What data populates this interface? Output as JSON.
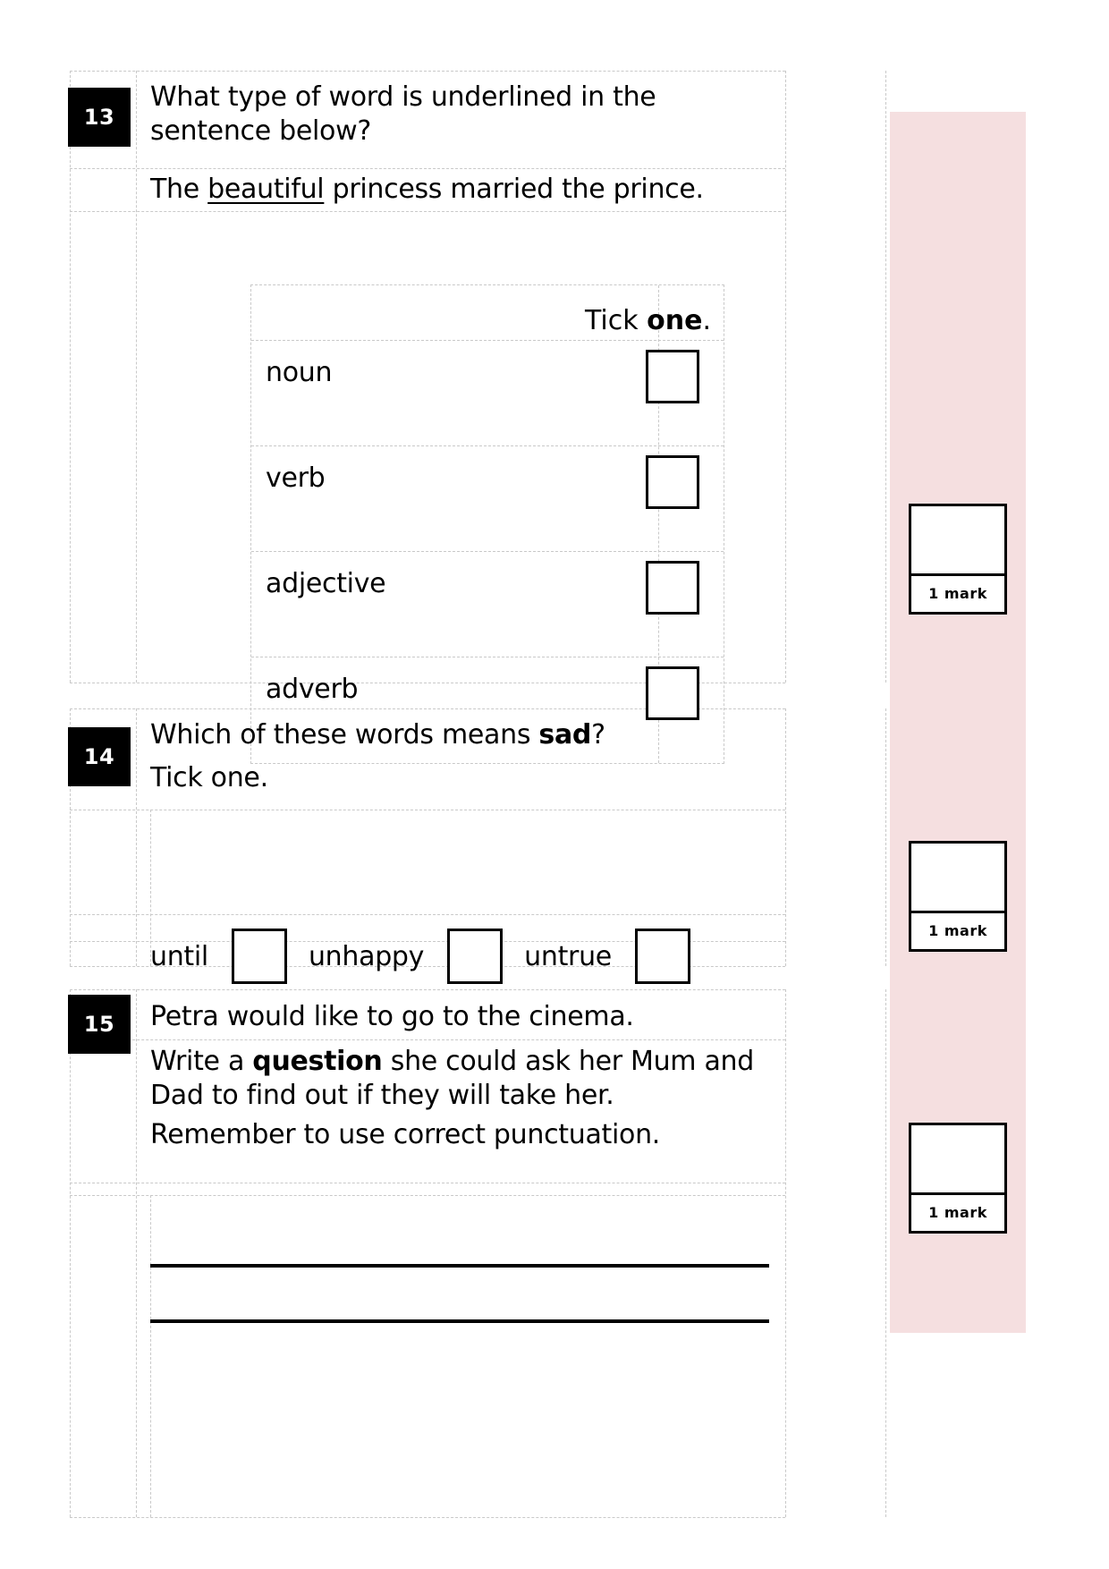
{
  "page": {
    "background_color": "#ffffff",
    "grid_color": "#c9c9c9",
    "mark_sidebar_color": "#f5dfe0"
  },
  "questions": [
    {
      "number": "13",
      "prompt": "What type of word is underlined in the sentence below?",
      "sentence_prefix": "The ",
      "sentence_underlined": "beautiful",
      "sentence_suffix": " princess married the prince.",
      "table": {
        "header_prefix": "Tick ",
        "header_bold": "one",
        "header_suffix": ".",
        "options": [
          "noun",
          "verb",
          "adjective",
          "adverb"
        ]
      },
      "mark": "1 mark"
    },
    {
      "number": "14",
      "prompt_prefix": "Which of these words means ",
      "prompt_bold": "sad",
      "prompt_suffix": "?",
      "instruction": "Tick one.",
      "options": [
        "until",
        "unhappy",
        "untrue"
      ],
      "mark": "1 mark"
    },
    {
      "number": "15",
      "line1": "Petra would like to go to the cinema.",
      "line2_prefix": "Write a ",
      "line2_bold": "question",
      "line2_suffix": " she could ask her Mum and Dad to find out if they will take her.",
      "line3": "Remember to use correct punctuation.",
      "mark": "1 mark"
    }
  ]
}
